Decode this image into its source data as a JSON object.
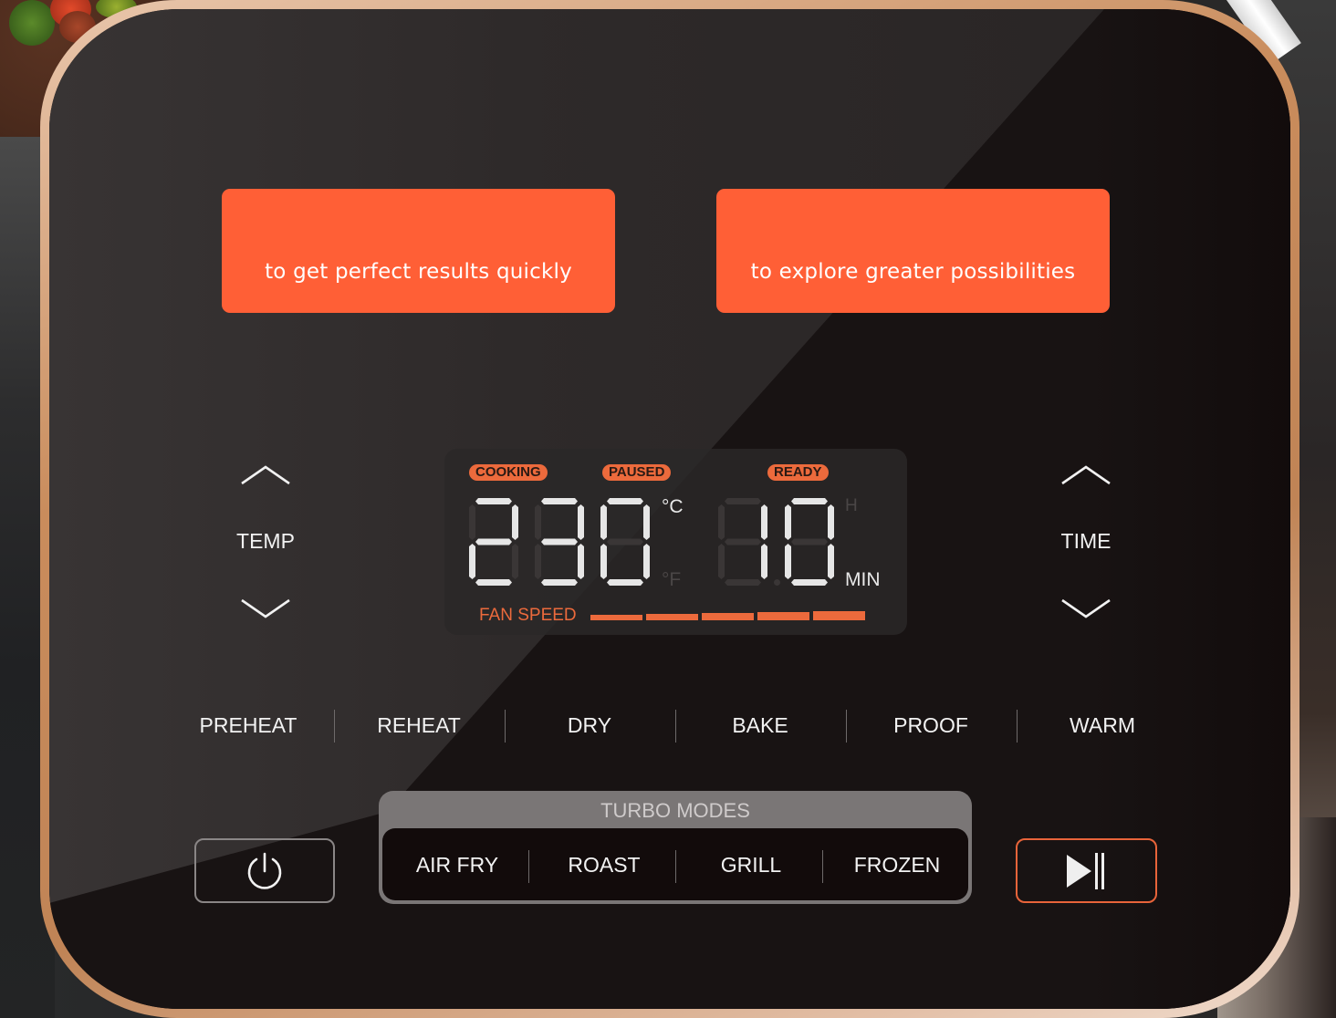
{
  "presets": [
    {
      "subtitle": "to get perfect results quickly"
    },
    {
      "subtitle": "to explore greater possibilities"
    }
  ],
  "temp": {
    "label": "TEMP",
    "up_icon": "chevron-up-icon",
    "down_icon": "chevron-down-icon"
  },
  "time": {
    "label": "TIME",
    "up_icon": "chevron-up-icon",
    "down_icon": "chevron-down-icon"
  },
  "display": {
    "status_badges": [
      "COOKING",
      "PAUSED",
      "READY"
    ],
    "temperature": "230",
    "temp_unit_active": "°C",
    "temp_unit_inactive": "°F",
    "time_value": "10",
    "time_unit_inactive": "H",
    "time_unit_active": "MIN",
    "fan_label": "FAN SPEED",
    "fan_level": 5,
    "fan_max": 5
  },
  "modes": [
    "PREHEAT",
    "REHEAT",
    "DRY",
    "BAKE",
    "PROOF",
    "WARM"
  ],
  "turbo": {
    "title": "TURBO MODES",
    "items": [
      "AIR FRY",
      "ROAST",
      "GRILL",
      "FROZEN"
    ]
  },
  "controls": {
    "power_icon": "power-icon",
    "start_pause_icon": "play-pause-icon"
  },
  "colors": {
    "accent": "#ff5f36",
    "lcd_accent": "#ec6a3c",
    "rim": "#c98c5c",
    "panel": "#120b0b",
    "segment_on": "#e6e6e6",
    "segment_off": "#3a3636"
  }
}
